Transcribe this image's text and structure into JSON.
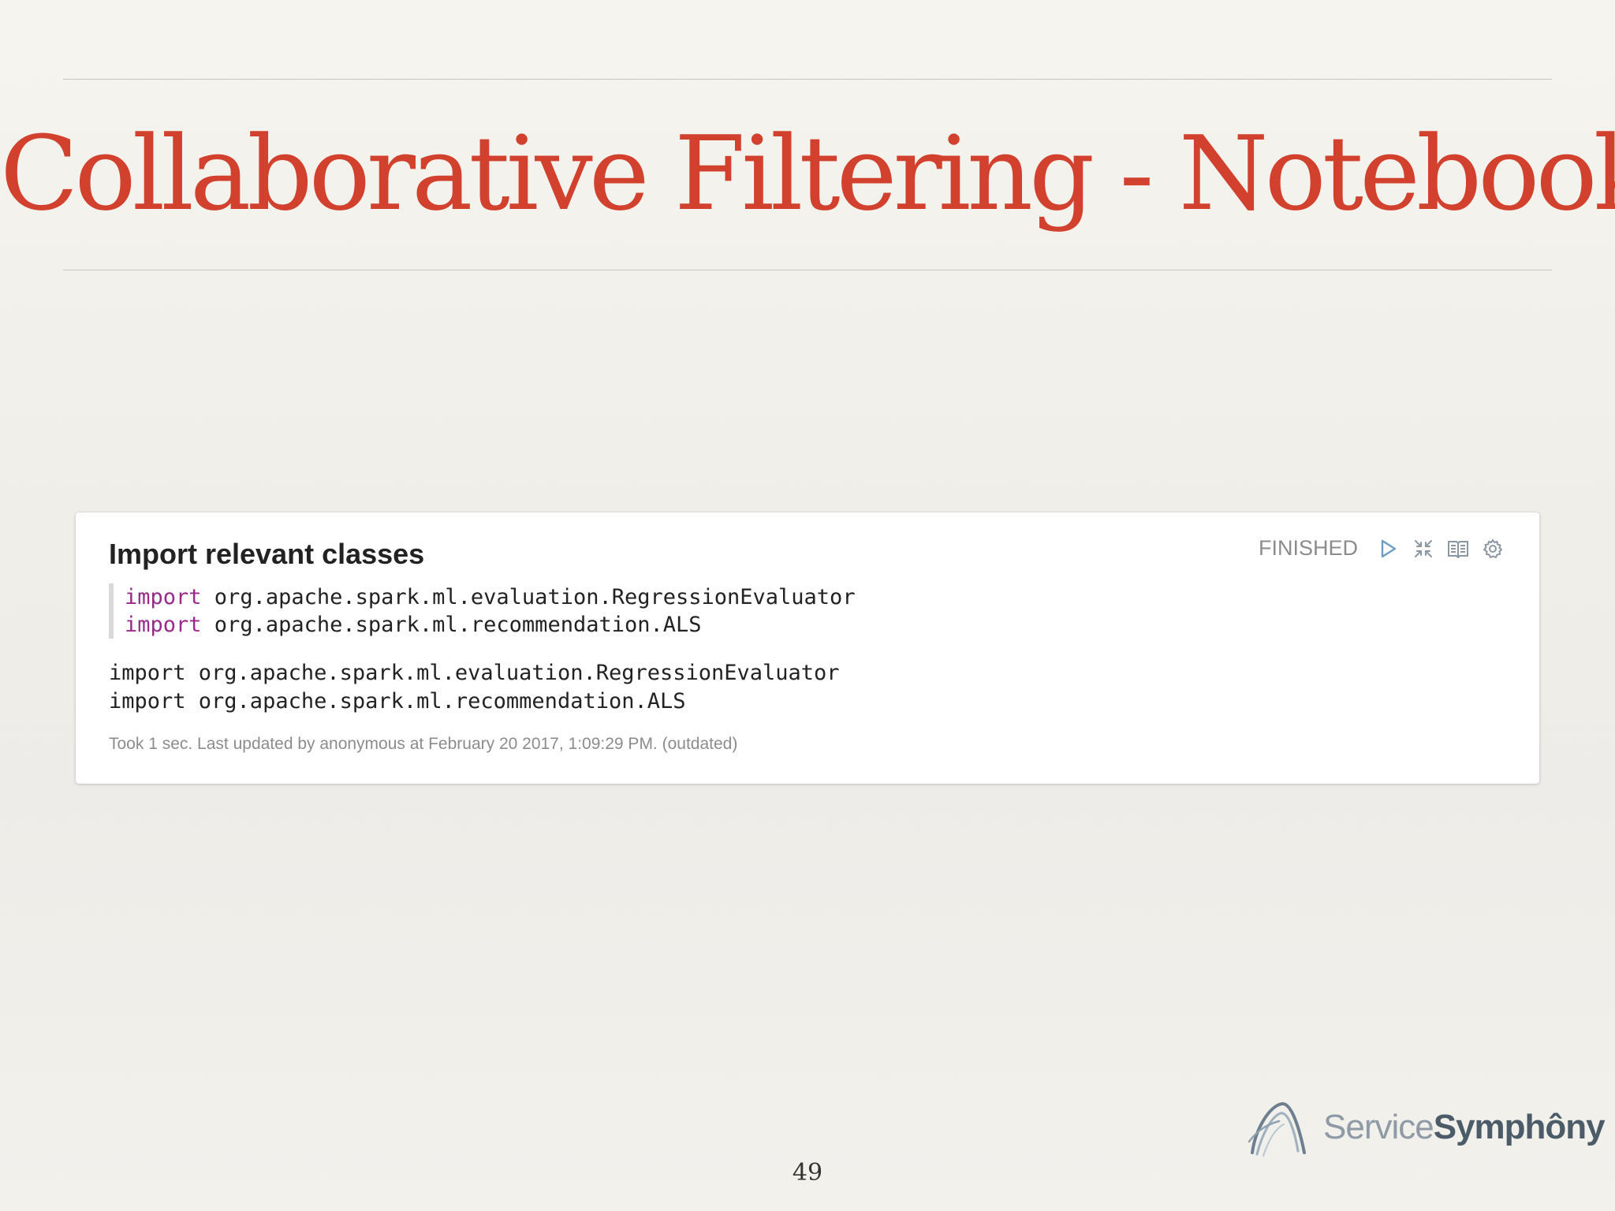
{
  "slide": {
    "title": "Collaborative Filtering - Notebook",
    "page_number": "49"
  },
  "paragraph": {
    "title": "Import relevant classes",
    "status": "FINISHED",
    "icons": [
      "run-icon",
      "collapse-icon",
      "book-icon",
      "gear-icon"
    ],
    "editor": {
      "lines": [
        {
          "keyword": "import",
          "rest": " org.apache.spark.ml.evaluation.RegressionEvaluator"
        },
        {
          "keyword": "import",
          "rest": " org.apache.spark.ml.recommendation.ALS"
        }
      ]
    },
    "output": {
      "lines": [
        "import org.apache.spark.ml.evaluation.RegressionEvaluator",
        "import org.apache.spark.ml.recommendation.ALS"
      ]
    },
    "footer": "Took 1 sec. Last updated by anonymous at February 20 2017, 1:09:29 PM. (outdated)"
  },
  "logo": {
    "light": "Service",
    "bold": "Symphôny"
  },
  "colors": {
    "title": "#d2402e",
    "keyword": "#9a2a8a",
    "status": "#8c8c8c",
    "icon": "#8aa0b3"
  }
}
